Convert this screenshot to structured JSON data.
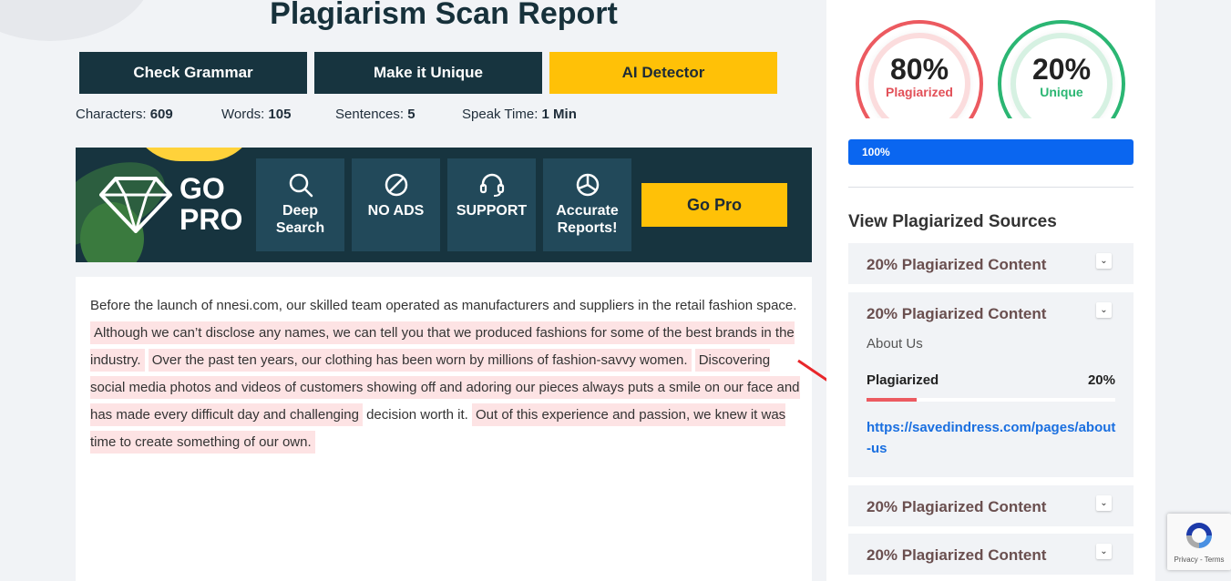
{
  "header": {
    "title": "Plagiarism Scan Report"
  },
  "actions": {
    "check_grammar": "Check Grammar",
    "make_unique": "Make it Unique",
    "ai_detector": "AI Detector"
  },
  "stats": {
    "characters_label": "Characters:",
    "characters": "609",
    "words_label": "Words:",
    "words": "105",
    "sentences_label": "Sentences:",
    "sentences": "5",
    "speak_label": "Speak Time:",
    "speak": "1 Min"
  },
  "gopro": {
    "line1": "GO",
    "line2": "PRO",
    "features": [
      {
        "icon": "search-icon",
        "label_1": "Deep",
        "label_2": "Search"
      },
      {
        "icon": "no-ads-icon",
        "label_1": "NO ADS",
        "label_2": ""
      },
      {
        "icon": "headset-icon",
        "label_1": "SUPPORT",
        "label_2": ""
      },
      {
        "icon": "pie-chart-icon",
        "label_1": "Accurate",
        "label_2": "Reports!"
      }
    ],
    "button": "Go Pro",
    "colors": {
      "panel": "#17343f",
      "tile": "#22495a",
      "accent": "#ffc107"
    }
  },
  "content": {
    "s0": "Before the launch of nnesi.com, our skilled team operated as manufacturers and suppliers in the retail fashion space.",
    "s1": "Although we can’t disclose any names, we can tell you that we produced fashions for some of the best brands in the industry.",
    "s2": "Over the past ten years, our clothing has been worn by millions of fashion-savvy women.",
    "s3": "Discovering social media photos and videos of customers showing off and adoring our pieces always puts a smile on our face and has made every difficult day and challenging",
    "s3b": "decision worth it.",
    "s4": "Out of this experience and passion, we knew it was time to create something of our own.",
    "highlight_color": "#fde3e4"
  },
  "results": {
    "plagiarized_pct": "80%",
    "plagiarized_label": "Plagiarized",
    "unique_pct": "20%",
    "unique_label": "Unique",
    "progress_label": "100%",
    "progress_value": 100,
    "colors": {
      "plagiarized": "#ec5a60",
      "unique": "#2bb673",
      "progress": "#0a66f0"
    }
  },
  "sources": {
    "title": "View Plagiarized Sources",
    "items": [
      {
        "heading": "20% Plagiarized Content"
      },
      {
        "heading": "20% Plagiarized Content",
        "page_title": "About Us",
        "metric_label": "Plagiarized",
        "metric_value": "20%",
        "metric_fraction": 0.2,
        "url": "https://savedindress.com/pages/about-us"
      },
      {
        "heading": "20% Plagiarized Content"
      },
      {
        "heading": "20% Plagiarized Content"
      }
    ]
  },
  "recaptcha": {
    "text": "Privacy - Terms"
  }
}
